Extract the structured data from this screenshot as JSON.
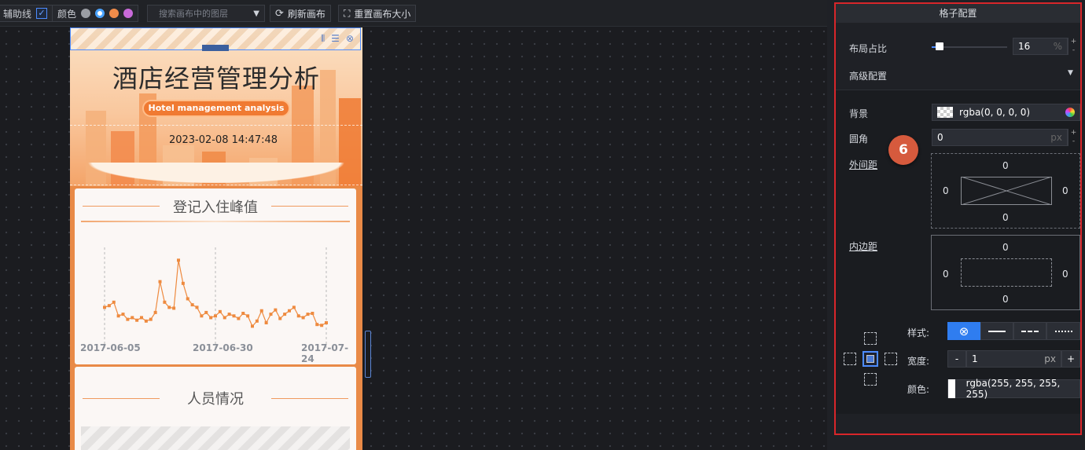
{
  "toolbar": {
    "guides_label": "辅助线",
    "color_label": "颜色",
    "colors": [
      "#9a9da3",
      "#4aa3ff",
      "#f08c4a",
      "#c86ad9"
    ],
    "search_placeholder": "搜索画布中的图层",
    "refresh_label": "刷新画布",
    "reset_label": "重置画布大小"
  },
  "header": {
    "title": "酒店经营管理分析",
    "subtitle": "Hotel management analysis",
    "datetime": "2023-02-08 14:47:48"
  },
  "card1": {
    "title": "登记入住峰值",
    "x_ticks": [
      "2017-06-05",
      "2017-06-30",
      "2017-07-24"
    ]
  },
  "card2": {
    "title": "人员情况"
  },
  "chart_data": {
    "type": "line",
    "title": "登记入住峰值",
    "categories_ticks": [
      "2017-06-05",
      "2017-06-30",
      "2017-07-24"
    ],
    "series": [
      {
        "values": [
          40,
          42,
          46,
          30,
          32,
          26,
          28,
          25,
          28,
          24,
          26,
          34,
          70,
          46,
          40,
          39,
          95,
          68,
          50,
          43,
          40,
          30,
          34,
          28,
          30,
          35,
          28,
          32,
          30,
          27,
          33,
          30,
          18,
          24,
          36,
          22,
          32,
          37,
          27,
          32,
          36,
          40,
          30,
          28,
          32,
          33,
          20,
          19,
          22
        ],
        "color": "#ee8a3f"
      }
    ],
    "ylim": [
      0,
      110
    ],
    "grid": false
  },
  "panel": {
    "title": "格子配置",
    "layout_ratio_label": "布局占比",
    "layout_ratio_value": "16",
    "layout_ratio_unit": "%",
    "layout_ratio_slider": 0.1,
    "advanced_label": "高级配置",
    "bg_label": "背景",
    "bg_value": "rgba(0, 0, 0, 0)",
    "radius_label": "圆角",
    "radius_value": "0",
    "radius_unit": "px",
    "margin_label": "外间距",
    "margin": {
      "top": "0",
      "left": "0",
      "right": "0",
      "bottom": "0"
    },
    "padding_label": "内边距",
    "padding": {
      "top": "0",
      "left": "0",
      "right": "0",
      "bottom": "0"
    },
    "style_label": "样式:",
    "width_label": "宽度:",
    "width_value": "1",
    "width_unit": "px",
    "color_label": "颜色:",
    "color_value": "rgba(255, 255, 255, 255)",
    "badge": "6",
    "plus": "+",
    "minus": "-"
  }
}
